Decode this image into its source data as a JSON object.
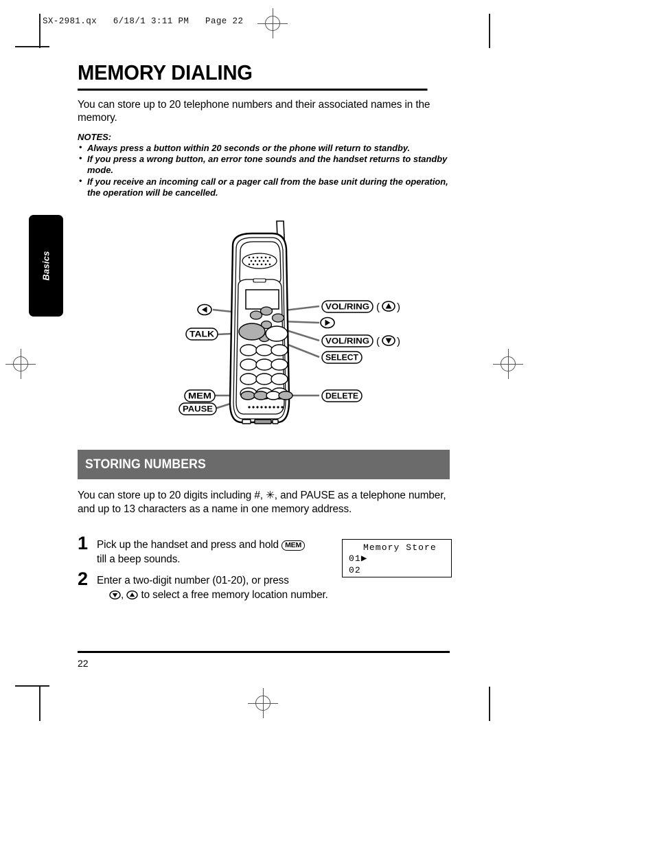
{
  "prepress": {
    "header": "SX-2981.qx   6/18/1 3:11 PM   Page 22"
  },
  "sidetab": {
    "label": "Basics"
  },
  "title": "MEMORY DIALING",
  "intro": "You can store up to 20 telephone numbers and their associated names in the memory.",
  "notes": {
    "label": "NOTES:",
    "items": [
      "Always press a button within 20 seconds or the phone will return to standby.",
      "If you press a wrong button, an error tone sounds and the handset returns to standby mode.",
      "If you receive an incoming call or a pager call from the base unit during the operation, the operation will be cancelled."
    ]
  },
  "diagram": {
    "callouts": {
      "left_arrow": "◀",
      "talk": "TALK",
      "mem": "MEM",
      "pause": "PAUSE",
      "vol_ring_up": "VOL/RING",
      "vol_ring_up_suffix_open": "(",
      "vol_ring_up_suffix_close": ")",
      "right_arrow": "▶",
      "vol_ring_down": "VOL/RING",
      "select": "SELECT",
      "delete": "DELETE"
    }
  },
  "section": {
    "heading": "STORING NUMBERS"
  },
  "body2": "You can store up to 20 digits including #, ✳, and PAUSE as a telephone number, and up to 13 characters as a name in one memory address.",
  "steps": [
    {
      "num": "1",
      "text_before": "Pick up the handset and press and hold",
      "key": "MEM",
      "text_after": "till a beep sounds."
    },
    {
      "num": "2",
      "text_before": "Enter a two-digit number (01-20), or press",
      "text_after": "to select a free memory location number.",
      "key_down": "▼",
      "key_up": "▲",
      "separator": ","
    }
  ],
  "lcd": {
    "line1": "Memory Store",
    "line2_num": "01",
    "line2_caret": "▶",
    "line3_num": "02"
  },
  "footer": {
    "page_number": "22"
  },
  "colors": {
    "section_bar": "#6b6b6b",
    "tab_bg": "#000000",
    "key_gray": "#b0b0b0",
    "reg_mark": "#555555"
  }
}
